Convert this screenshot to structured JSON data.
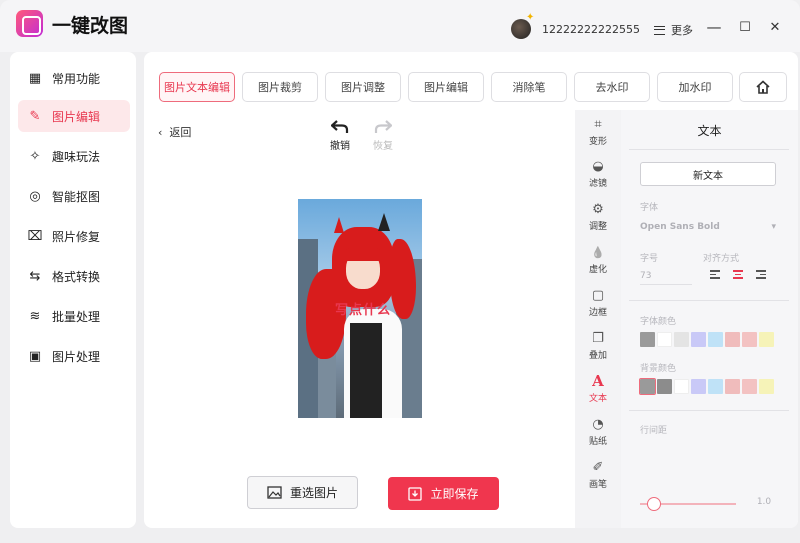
{
  "app": {
    "title": "一键改图"
  },
  "header": {
    "user_name": "12222222222555",
    "more_label": "更多",
    "minimize": "—",
    "maximize": "☐",
    "close": "✕"
  },
  "sidebar": {
    "items": [
      {
        "label": "常用功能",
        "icon": "grid-icon",
        "glyph": "▦"
      },
      {
        "label": "图片编辑",
        "icon": "edit-icon",
        "glyph": "✎",
        "active": true
      },
      {
        "label": "趣味玩法",
        "icon": "magic-wand-icon",
        "glyph": "✧"
      },
      {
        "label": "智能抠图",
        "icon": "cutout-icon",
        "glyph": "◎"
      },
      {
        "label": "照片修复",
        "icon": "restore-icon",
        "glyph": "⌧"
      },
      {
        "label": "格式转换",
        "icon": "convert-icon",
        "glyph": "⇆"
      },
      {
        "label": "批量处理",
        "icon": "layers-icon",
        "glyph": "≋"
      },
      {
        "label": "图片处理",
        "icon": "image-icon",
        "glyph": "▣"
      }
    ]
  },
  "tabs": [
    {
      "label": "图片文本编辑",
      "active": true
    },
    {
      "label": "图片裁剪"
    },
    {
      "label": "图片调整"
    },
    {
      "label": "图片编辑"
    },
    {
      "label": "消除笔"
    },
    {
      "label": "去水印"
    },
    {
      "label": "加水印"
    }
  ],
  "canvas": {
    "back_label": "返回",
    "undo_label": "撤销",
    "redo_label": "恢复",
    "overlay_text": "写点什么",
    "reselect_label": "重选图片",
    "save_label": "立即保存"
  },
  "toolstrip": [
    {
      "label": "变形",
      "icon": "transform-icon",
      "glyph": "⌗"
    },
    {
      "label": "滤镜",
      "icon": "filter-icon",
      "glyph": "◒"
    },
    {
      "label": "调整",
      "icon": "adjust-icon",
      "glyph": "⚙"
    },
    {
      "label": "虚化",
      "icon": "blur-icon",
      "glyph": "💧"
    },
    {
      "label": "边框",
      "icon": "border-icon",
      "glyph": "▢"
    },
    {
      "label": "叠加",
      "icon": "overlay-icon",
      "glyph": "❐"
    },
    {
      "label": "文本",
      "icon": "text-icon",
      "glyph": "A",
      "active": true
    },
    {
      "label": "贴纸",
      "icon": "sticker-icon",
      "glyph": "◔"
    },
    {
      "label": "画笔",
      "icon": "brush-icon",
      "glyph": "✐"
    }
  ],
  "panel": {
    "title": "文本",
    "new_text_label": "新文本",
    "font_label": "字体",
    "font_value": "Open Sans Bold",
    "size_label": "字号",
    "size_value": "73",
    "align_label": "对齐方式",
    "font_color_label": "字体颜色",
    "bg_color_label": "背景颜色",
    "line_spacing_label": "行间距",
    "line_spacing_value": "1.0",
    "line_spacing_fraction": 0.15,
    "font_colors": [
      "#9a9a9a",
      "#ffffff",
      "#e4e4e4",
      "#c9c9f7",
      "#bfe2f7",
      "#f0bcbc",
      "#f3c2c2",
      "#f6f3b8"
    ],
    "bg_colors": [
      "#9a9a9a",
      "#8c8c8c",
      "#ffffff",
      "#c9c9f7",
      "#bfe2f7",
      "#f0bcbc",
      "#f3c2c2",
      "#f6f3b8"
    ]
  }
}
